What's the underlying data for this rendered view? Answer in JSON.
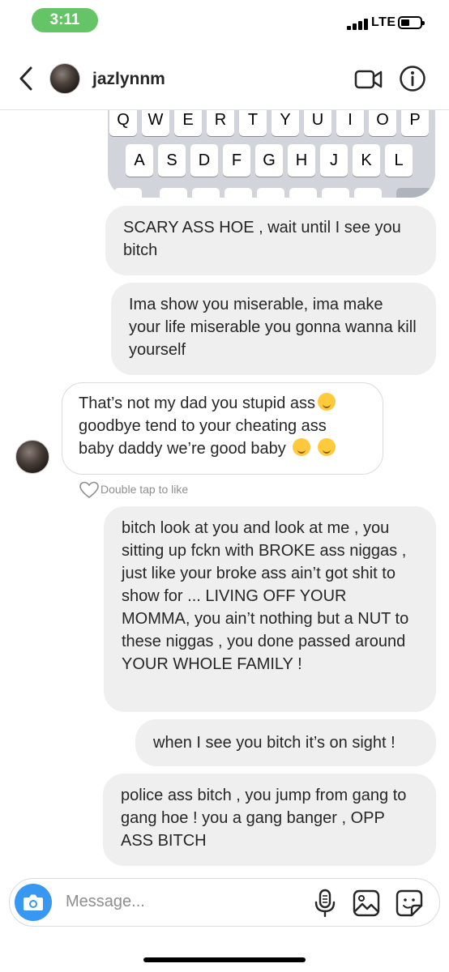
{
  "status_bar": {
    "time": "3:11",
    "network": "LTE",
    "time_pill_color": "#65c466"
  },
  "header": {
    "username": "jazlynnm",
    "icons": [
      "back-chevron-icon",
      "video-call-icon",
      "info-icon"
    ]
  },
  "keyboard": {
    "row1": [
      "Q",
      "W",
      "E",
      "R",
      "T",
      "Y",
      "U",
      "I",
      "O",
      "P"
    ],
    "row2": [
      "A",
      "S",
      "D",
      "F",
      "G",
      "H",
      "J",
      "K",
      "L"
    ]
  },
  "messages": [
    {
      "from": "me",
      "text": "SCARY ASS HOE , wait until I see you bitch"
    },
    {
      "from": "me",
      "text": "Ima show you miserable, ima make your life miserable you gonna wanna kill yourself"
    },
    {
      "from": "them",
      "text_line1": "That’s not my dad you stupid ass",
      "text_line2": "goodbye tend to your cheating ass",
      "text_line3": "baby daddy we’re good baby",
      "emojis": [
        "face-with-tears-of-joy",
        "face-blowing-kiss",
        "winking-face"
      ]
    },
    {
      "from": "me",
      "text": "bitch look at you and look at me , you sitting up fckn with BROKE ass niggas , just like your broke ass ain’t got shit to show for ... LIVING OFF YOUR MOMMA, you ain’t nothing but a NUT to these niggas , you done passed around YOUR WHOLE FAMILY !"
    },
    {
      "from": "me",
      "text": "when I see you bitch it’s on sight !"
    },
    {
      "from": "me",
      "text": "police ass bitch , you jump from gang to gang hoe ! you a gang banger , OPP ASS BITCH"
    }
  ],
  "like_hint": "Double tap to like",
  "composer": {
    "placeholder": "Message...",
    "accent": "#3897f0"
  },
  "colors": {
    "sent_bubble": "#efefef",
    "received_border": "#dbdbdb",
    "text": "#262626"
  }
}
